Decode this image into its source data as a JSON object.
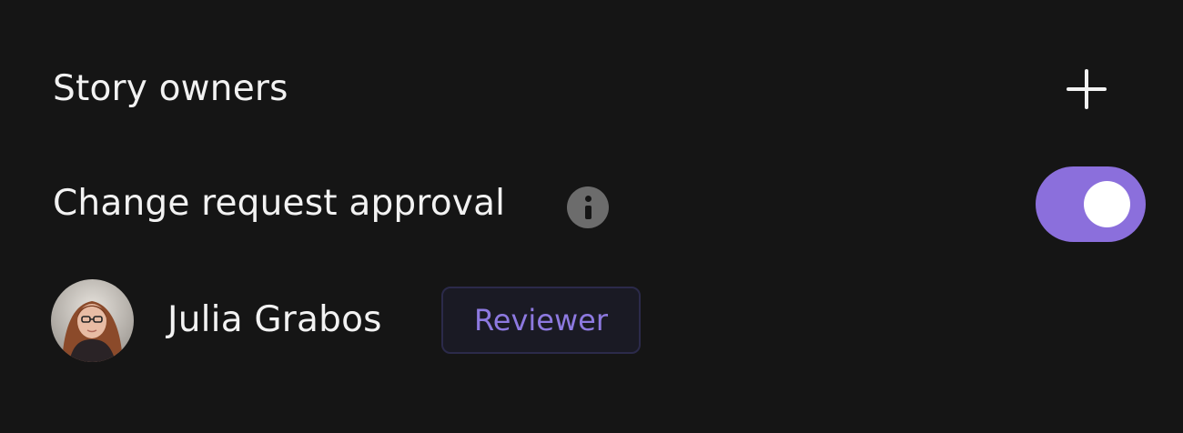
{
  "story_owners": {
    "title": "Story owners",
    "add_icon": "plus-icon"
  },
  "approval": {
    "label": "Change request approval",
    "info_icon": "info-icon",
    "enabled": true,
    "toggle_color": "#8b6fdc"
  },
  "owner": {
    "name": "Julia Grabos",
    "role": "Reviewer",
    "role_color": "#8d79e0"
  }
}
